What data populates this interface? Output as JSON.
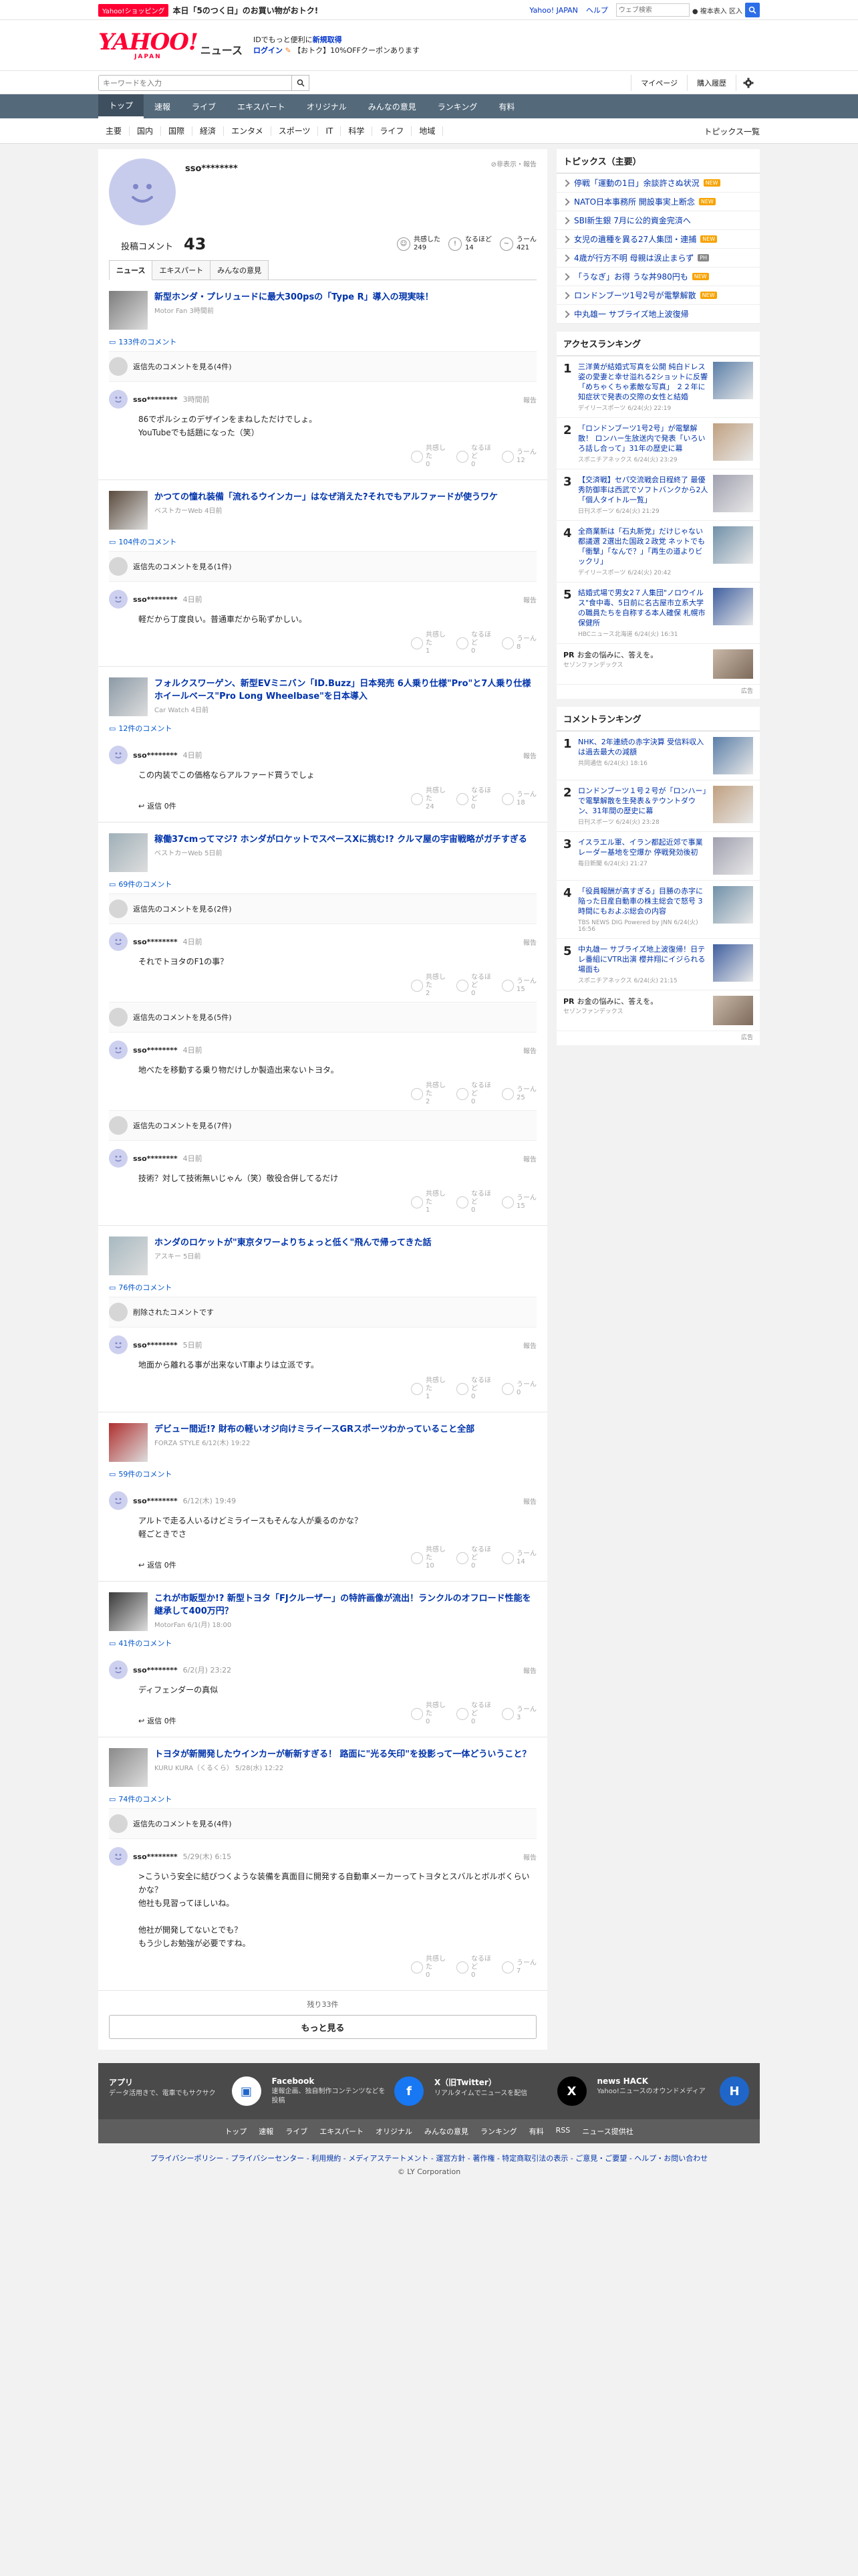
{
  "topbar": {
    "shop_badge": "Yahoo!ショッピング",
    "shop_text": "本日「5のつく日」のお買い物がおトク!",
    "links": [
      "Yahoo! JAPAN",
      "ヘルプ"
    ],
    "search_placeholder": "ウェブ検索",
    "radio": "● 複本表入 区入"
  },
  "header": {
    "logo": "YAHOO!",
    "logo_sub": "JAPAN",
    "logo_news": "ニュース",
    "promo_line1": "IDでもっと便利に",
    "promo_line1b": "新規取得",
    "promo_login": "ログイン",
    "promo_line2": "【おトク】10%OFFクーポンあります"
  },
  "search": {
    "placeholder": "キーワードを入力",
    "mypage": "マイページ",
    "history": "購入履歴"
  },
  "nav": [
    "トップ",
    "速報",
    "ライブ",
    "エキスパート",
    "オリジナル",
    "みんなの意見",
    "ランキング",
    "有料"
  ],
  "subnav": [
    "主要",
    "国内",
    "国際",
    "経済",
    "エンタメ",
    "スポーツ",
    "IT",
    "科学",
    "ライフ",
    "地域"
  ],
  "subnav_all": "トピックス一覧",
  "profile": {
    "name": "sso********",
    "report": "非表示・報告",
    "count_label": "投稿コメント",
    "count": "43",
    "reactions": [
      {
        "label": "共感した",
        "value": "249",
        "icon": "smile-icon"
      },
      {
        "label": "なるほど",
        "value": "14",
        "icon": "bulb-icon"
      },
      {
        "label": "うーん",
        "value": "421",
        "icon": "meh-icon"
      }
    ]
  },
  "tabs": [
    "ニュース",
    "エキスパート",
    "みんなの意見"
  ],
  "articles": [
    {
      "title": "新型ホンダ・プレリュードに最大300psの「Type R」導入の現実味！",
      "source": "Motor Fan 3時間前",
      "count": "133件のコメント",
      "parent": "返信先のコメントを見る(4件)",
      "comments": [
        {
          "name": "sso********",
          "time": "3時間前",
          "text": "86でポルシェのデザインをまねしただけでしょ。\nYouTubeでも話題になった（笑）",
          "r": [
            "0",
            "0",
            "12"
          ]
        }
      ]
    },
    {
      "title": "かつての憧れ装備「流れるウインカー」はなぜ消えた?それでもアルファードが使うワケ",
      "source": "ベストカーWeb 4日前",
      "count": "104件のコメント",
      "parent": "返信先のコメントを見る(1件)",
      "comments": [
        {
          "name": "sso********",
          "time": "4日前",
          "text": "軽だから丁度良い。普通車だから恥ずかしい。",
          "r": [
            "1",
            "0",
            "8"
          ]
        }
      ]
    },
    {
      "title": "フォルクスワーゲン、新型EVミニバン「ID.Buzz」日本発売 6人乗り仕様\"Pro\"と7人乗り仕様ホイールベース\"Pro Long Wheelbase\"を日本導入",
      "source": "Car Watch 4日前",
      "count": "12件のコメント",
      "parent": "",
      "comments": [
        {
          "name": "sso********",
          "time": "4日前",
          "text": "この内装でこの価格ならアルファード買うでしょ",
          "r": [
            "24",
            "0",
            "18"
          ],
          "reply": "返信 0件"
        }
      ]
    },
    {
      "title": "稼働37cmってマジ? ホンダがロケットでスペースXに挑む!? クルマ屋の宇宙戦略がガチすぎる",
      "source": "ベストカーWeb 5日前",
      "count": "69件のコメント",
      "parent": "返信先のコメントを見る(2件)",
      "comments": [
        {
          "name": "sso********",
          "time": "4日前",
          "text": "それでトヨタのF1の事？",
          "r": [
            "2",
            "0",
            "15"
          ]
        },
        {
          "parent": "返信先のコメントを見る(5件)",
          "name": "sso********",
          "time": "4日前",
          "text": "地べたを移動する乗り物だけしか製造出来ないトヨタ。",
          "r": [
            "2",
            "0",
            "25"
          ]
        },
        {
          "parent": "返信先のコメントを見る(7件)",
          "name": "sso********",
          "time": "4日前",
          "text": "技術？対して技術無いじゃん（笑）敬役合併してるだけ",
          "r": [
            "1",
            "0",
            "15"
          ]
        }
      ]
    },
    {
      "title": "ホンダのロケットが\"東京タワーよりちょっと低く\"飛んで帰ってきた話",
      "source": "アスキー 5日前",
      "count": "76件のコメント",
      "parent": "削除されたコメントです",
      "comments": [
        {
          "name": "sso********",
          "time": "5日前",
          "text": "地面から離れる事が出来ないT車よりは立派です。",
          "r": [
            "1",
            "0",
            "0"
          ]
        }
      ]
    },
    {
      "title": "デビュー間近!? 財布の軽いオジ向けミライースGRスポーツわかっていること全部",
      "source": "FORZA STYLE 6/12(木) 19:22",
      "count": "59件のコメント",
      "parent": "",
      "comments": [
        {
          "name": "sso********",
          "time": "6/12(木) 19:49",
          "text": "アルトで走る人いるけどミライースもそんな人が乗るのかな？\n軽ごときでさ",
          "r": [
            "10",
            "0",
            "14"
          ],
          "reply": "返信 0件"
        }
      ]
    },
    {
      "title": "これが市販型か!? 新型トヨタ「FJクルーザー」の特許画像が流出！ランクルのオフロード性能を継承して400万円？",
      "source": "MotorFan 6/1(月) 18:00",
      "count": "41件のコメント",
      "parent": "",
      "comments": [
        {
          "name": "sso********",
          "time": "6/2(月) 23:22",
          "text": "ディフェンダーの真似",
          "r": [
            "0",
            "0",
            "3"
          ],
          "reply": "返信 0件"
        }
      ]
    },
    {
      "title": "トヨタが新開発したウインカーが斬新すぎる！ 路面に\"光る矢印\"を投影って一体どういうこと？",
      "source": "KURU KURA（くるくら） 5/28(水) 12:22",
      "count": "74件のコメント",
      "parent": "返信先のコメントを見る(4件)",
      "comments": [
        {
          "name": "sso********",
          "time": "5/29(木) 6:15",
          "text": ">こういう安全に結びつくような装備を真面目に開発する自動車メーカーってトヨタとスバルとボルボくらいかな？\n他社も見習ってほしいね。\n\n他社が開発してないとでも？\nもう少しお勉強が必要ですね。",
          "r": [
            "0",
            "0",
            "7"
          ]
        }
      ]
    }
  ],
  "more": {
    "remaining": "残り33件",
    "button": "もっと見る"
  },
  "right": {
    "topics_title": "トピックス（主要）",
    "topics": [
      {
        "t": "停戦「運動の1日」余談許さぬ状況",
        "b": "NEW"
      },
      {
        "t": "NATO日本事務所 開設事実上断念",
        "b": "NEW"
      },
      {
        "t": "SBI新生銀 7月に公的資金完済へ",
        "b": ""
      },
      {
        "t": "女児の遺種を異る27人集団・連捕",
        "b": "NEW"
      },
      {
        "t": "4歳が行方不明 母親は涙止まらず",
        "b": "PH"
      },
      {
        "t": "「うなぎ」お得 うな丼980円も",
        "b": "NEW"
      },
      {
        "t": "ロンドンブーツ1号2号が電撃解散",
        "b": "NEW"
      },
      {
        "t": "中丸雄一 サブライズ地上波復帰",
        "b": ""
      }
    ],
    "access_title": "アクセスランキング",
    "access": [
      {
        "n": "1",
        "t": "三洋黄が結婚式写真を公開 純白ドレス姿の愛妻と幸せ溢れる2ショットに反響「めちゃくちゃ素敵な写真」 ２２年に知症状で発表の交際の女性と結婚",
        "m": "デイリースポーツ 6/24(火) 22:19"
      },
      {
        "n": "2",
        "t": "「ロンドンブーツ1号2号」が電撃解散！ ロンハー生放送内で発表「いろいろ話し合って」31年の歴史に幕",
        "m": "スポニチアネックス 6/24(火) 23:29"
      },
      {
        "n": "3",
        "t": "【交済戦】セパ交流戦会日程終了 最優秀防御率は西武でソフトバンクから2人「個人タイトル一覧」",
        "m": "日刊スポーツ 6/24(火) 21:29"
      },
      {
        "n": "4",
        "t": "全商業新は「石丸新党」だけじゃない 都議選 2選出た国政２政党 ネットでも「衝撃」「なんで？」「再生の道よりビックリ」",
        "m": "デイリースポーツ 6/24(火) 20:42"
      },
      {
        "n": "5",
        "t": "結婚式場で男女2７人集団\"ノロウイルス\"食中毒、5日前に名古屋市立系大学の職員たちを自称する本人確保 札幌市保健所",
        "m": "HBCニュース北海道 6/24(火) 16:31"
      }
    ],
    "pr1": {
      "t": "お金の悩みに、答えを。",
      "s": "セゾンファンデックス"
    },
    "comment_title": "コメントランキング",
    "comments": [
      {
        "n": "1",
        "t": "NHK、2年連続の赤字決算 受信料収入は過去最大の減額",
        "m": "共同通信 6/24(火) 18:16"
      },
      {
        "n": "2",
        "t": "ロンドンブーツ１号２号が「ロンハー」で電撃解散を生発表＆テウントダウン、31年間の歴史に幕",
        "m": "日刊スポーツ 6/24(火) 23:28"
      },
      {
        "n": "3",
        "t": "イスラエル軍、イラン都起近郊で事業レーダー基地を空爆か 停戦発効後初",
        "m": "毎日新聞 6/24(火) 21:27"
      },
      {
        "n": "4",
        "t": "「役員報酬が高すぎる」目勝の赤字に陥った日産自動車の株主総会で怒号 3時間にもおよぶ総会の内容",
        "m": "TBS NEWS DIG Powered by JNN 6/24(火) 16:56"
      },
      {
        "n": "5",
        "t": "中丸雄一 サブライズ地上波復帰！日テレ番組にVTR出演 櫻井翔にイジられる場面も",
        "m": "スポニチアネックス 6/24(火) 21:15"
      }
    ],
    "pr2": {
      "t": "お金の悩みに、答えを。",
      "s": "セゾンファンデックス"
    },
    "ad_label": "広告"
  },
  "footer": {
    "cards": [
      {
        "h": "アプリ",
        "d": "データ活用きで、電車でもサクサク"
      },
      {
        "h": "Facebook",
        "d": "速報企画、独自制作コンテンツなどを投稿"
      },
      {
        "h": "X（旧Twitter）",
        "d": "リアルタイムでニュースを配信"
      },
      {
        "h": "news HACK",
        "d": "Yahoo!ニュースのオウンドメディア"
      }
    ],
    "nav": [
      "トップ",
      "速報",
      "ライブ",
      "エキスパート",
      "オリジナル",
      "みんなの意見",
      "ランキング",
      "有料",
      "RSS",
      "ニュース提供社"
    ],
    "legal": "プライバシーポリシー - プライバシーセンター - 利用規約 - メディアステートメント - 運営方針 - 著作権 - 特定商取引法の表示 - ご意見・ご要望 - ヘルプ・お問い合わせ",
    "copy": "© LY Corporation"
  },
  "colors": {
    "accent": "#0033aa",
    "nav": "#546a7b",
    "brand_red": "#ff0033"
  }
}
